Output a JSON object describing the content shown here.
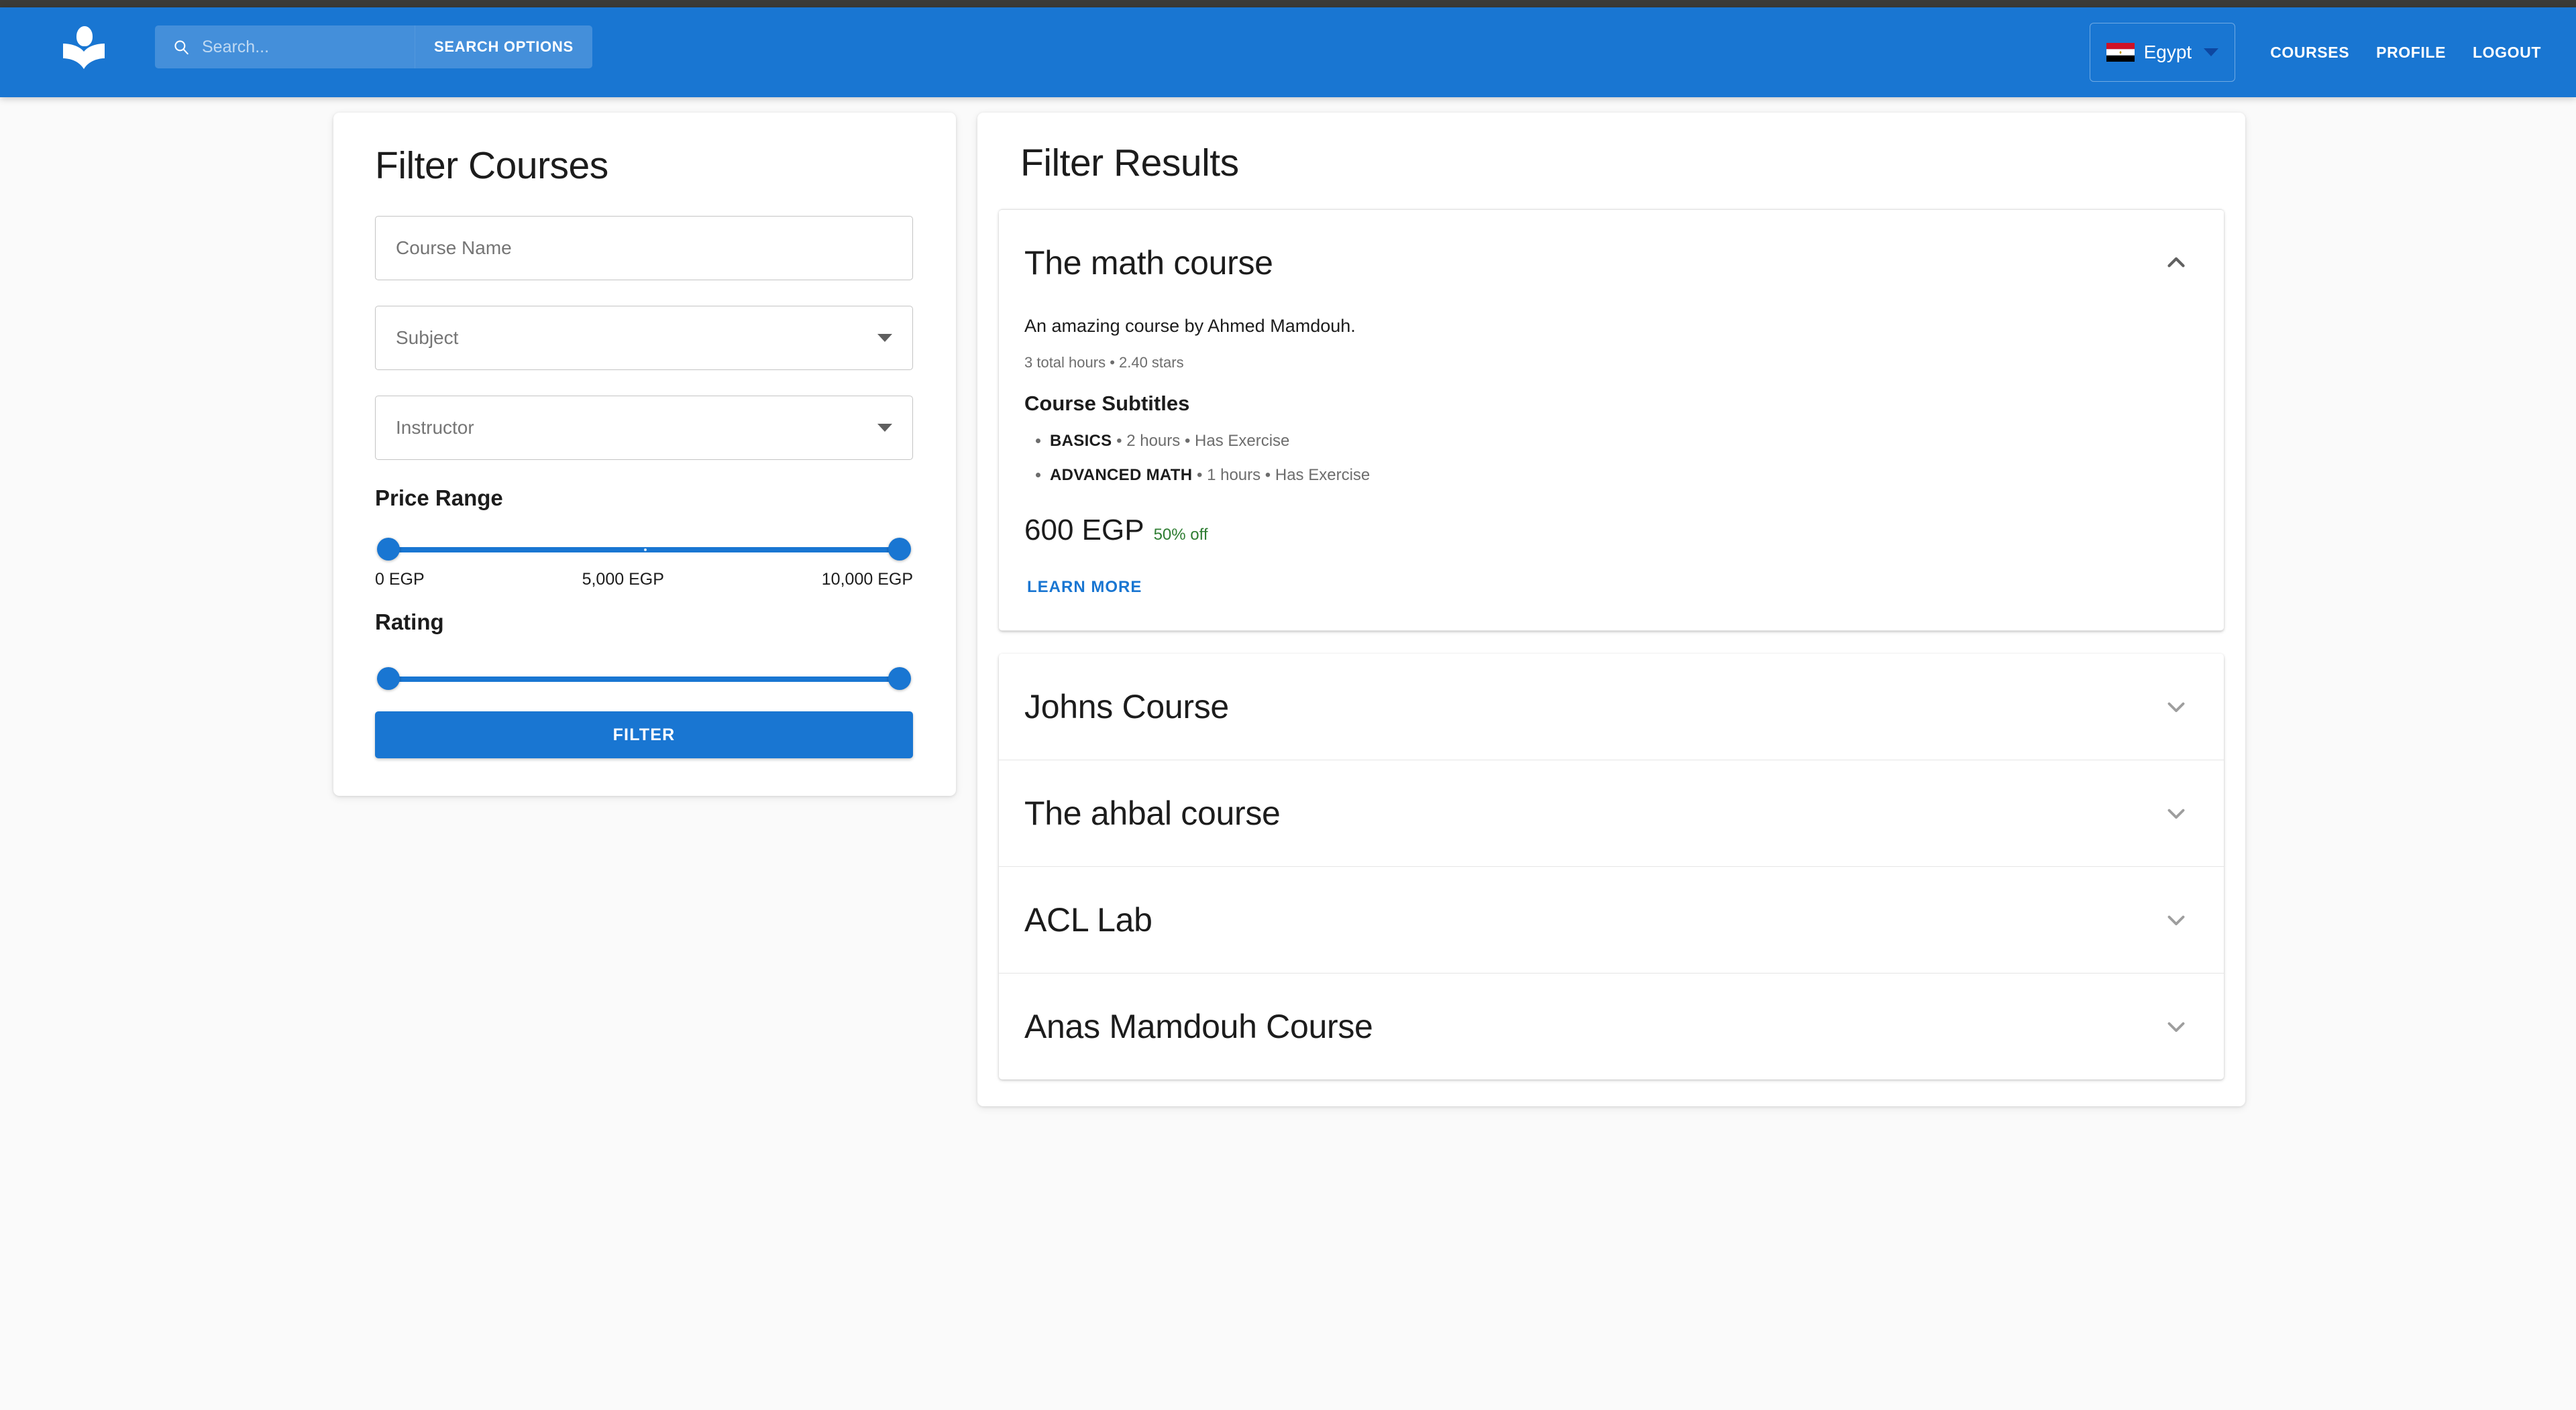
{
  "header": {
    "logo_icon": "book-reader-logo-icon",
    "search": {
      "icon": "search-icon",
      "placeholder": "Search...",
      "value": "",
      "options_label": "SEARCH OPTIONS"
    },
    "country": {
      "flag_icon": "egypt-flag-icon",
      "label": "Egypt",
      "caret_icon": "caret-down-icon"
    },
    "nav": [
      {
        "label": "COURSES"
      },
      {
        "label": "PROFILE"
      },
      {
        "label": "LOGOUT"
      }
    ],
    "accent_color": "#1976d2"
  },
  "filter_panel": {
    "title": "Filter Courses",
    "course_name": {
      "placeholder": "Course Name",
      "value": ""
    },
    "subject": {
      "label": "Subject",
      "value": ""
    },
    "instructor": {
      "label": "Instructor",
      "value": ""
    },
    "price_range": {
      "label": "Price Range",
      "ticks": [
        "0 EGP",
        "5,000 EGP",
        "10,000 EGP"
      ],
      "min": 0,
      "max": 10000,
      "selected_min": 0,
      "selected_max": 10000
    },
    "rating": {
      "label": "Rating",
      "min": 0,
      "max": 5,
      "selected_min": 0,
      "selected_max": 5
    },
    "submit_label": "FILTER"
  },
  "results_panel": {
    "title": "Filter Results",
    "expanded_course": {
      "title": "The math course",
      "chevron_icon": "chevron-up-icon",
      "description": "An amazing course by Ahmed Mamdouh.",
      "meta": "3 total hours • 2.40 stars",
      "subtitles_heading": "Course Subtitles",
      "subtitles": [
        {
          "name": "BASICS",
          "detail": " • 2 hours • Has Exercise"
        },
        {
          "name": "ADVANCED MATH",
          "detail": " • 1 hours • Has Exercise"
        }
      ],
      "price": "600 EGP",
      "discount": "50% off",
      "discount_color": "#2e7d32",
      "learn_more_label": "LEARN MORE"
    },
    "collapsed_courses": [
      {
        "title": "Johns Course",
        "chevron_icon": "chevron-down-icon"
      },
      {
        "title": "The ahbal course",
        "chevron_icon": "chevron-down-icon"
      },
      {
        "title": "ACL Lab",
        "chevron_icon": "chevron-down-icon"
      },
      {
        "title": "Anas Mamdouh Course",
        "chevron_icon": "chevron-down-icon"
      }
    ]
  }
}
